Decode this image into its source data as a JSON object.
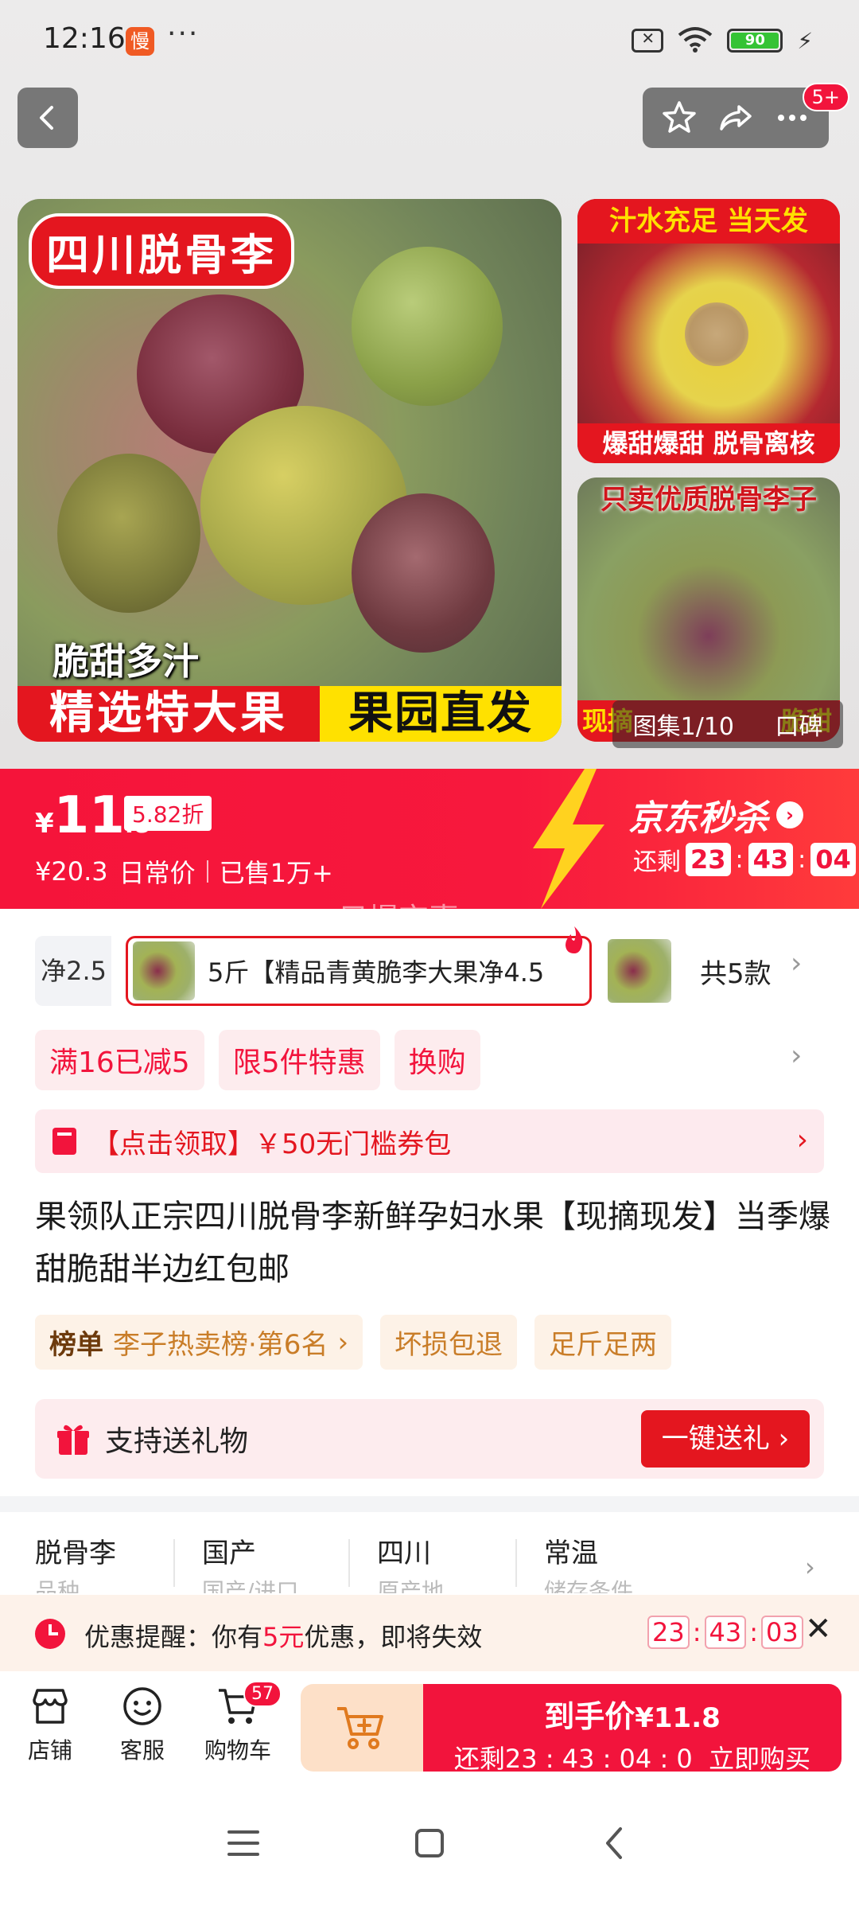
{
  "status_bar": {
    "time": "12:16",
    "app_badge": "慢",
    "more": "···",
    "battery_level": "90"
  },
  "header": {
    "more_badge": "5+"
  },
  "gallery": {
    "main_tag": "四川脱骨李",
    "main_subtitle": "脆甜多汁",
    "main_banner_left": "精选特大果",
    "main_banner_right": "果园直发",
    "side1_top": "汁水充足 当天发",
    "side1_bottom": "爆甜爆甜 脱骨离核",
    "side2_top": "只卖优质脱骨李子",
    "side2_bottom": "现摘",
    "side2_bottom_tail": "脆甜",
    "gallery_label": "图集1/10",
    "reviews_label": "口碑"
  },
  "price": {
    "symbol": "¥",
    "integer": "11",
    "decimal": ".8",
    "discount": "5.82折",
    "original": "¥20.3",
    "original_label": "日常价",
    "sold": "已售1万+",
    "watermark": "只爆京喜"
  },
  "seckill": {
    "title": "京东秒杀",
    "arrow": "›",
    "remaining_label": "还剩",
    "hh": "23",
    "mm": "43",
    "ss": "04"
  },
  "sku": {
    "prev_label": "净2.5",
    "selected_label": "5斤【精品青黄脆李大果净4.5",
    "count_label": "共5款"
  },
  "promos": {
    "items": [
      "满16已减5",
      "限5件特惠",
      "换购"
    ]
  },
  "coupon": {
    "text": "【点击领取】￥50无门槛券包"
  },
  "product": {
    "title": "果领队正宗四川脱骨李新鲜孕妇水果【现摘现发】当季爆甜脆甜半边红包邮"
  },
  "badges": {
    "rank_label": "榜单",
    "rank_value": "李子热卖榜·第6名",
    "tags": [
      "坏损包退",
      "足斤足两"
    ]
  },
  "gift": {
    "text": "支持送礼物",
    "button": "一键送礼 ›"
  },
  "specs": {
    "items": [
      {
        "value": "脱骨李",
        "sub": "品种"
      },
      {
        "value": "国产",
        "sub": "国产/进口"
      },
      {
        "value": "四川",
        "sub": "原产地"
      },
      {
        "value": "常温",
        "sub": "储存条件"
      }
    ]
  },
  "reminder": {
    "prefix": "优惠提醒：你有",
    "highlight": "5元",
    "suffix": "优惠，即将失效",
    "hh": "23",
    "mm": "43",
    "ss": "03"
  },
  "bottom_bar": {
    "store_label": "店铺",
    "service_label": "客服",
    "cart_label": "购物车",
    "cart_count": "57",
    "buy_top_label": "到手价",
    "buy_price": "¥11.8",
    "buy_countdown": "还剩23 : 43 : 04 : 0",
    "buy_action": "立即购买"
  },
  "colors": {
    "brand_red": "#f2143c",
    "seckill_yellow": "#ffe100",
    "promo_bg": "#fdecee"
  }
}
